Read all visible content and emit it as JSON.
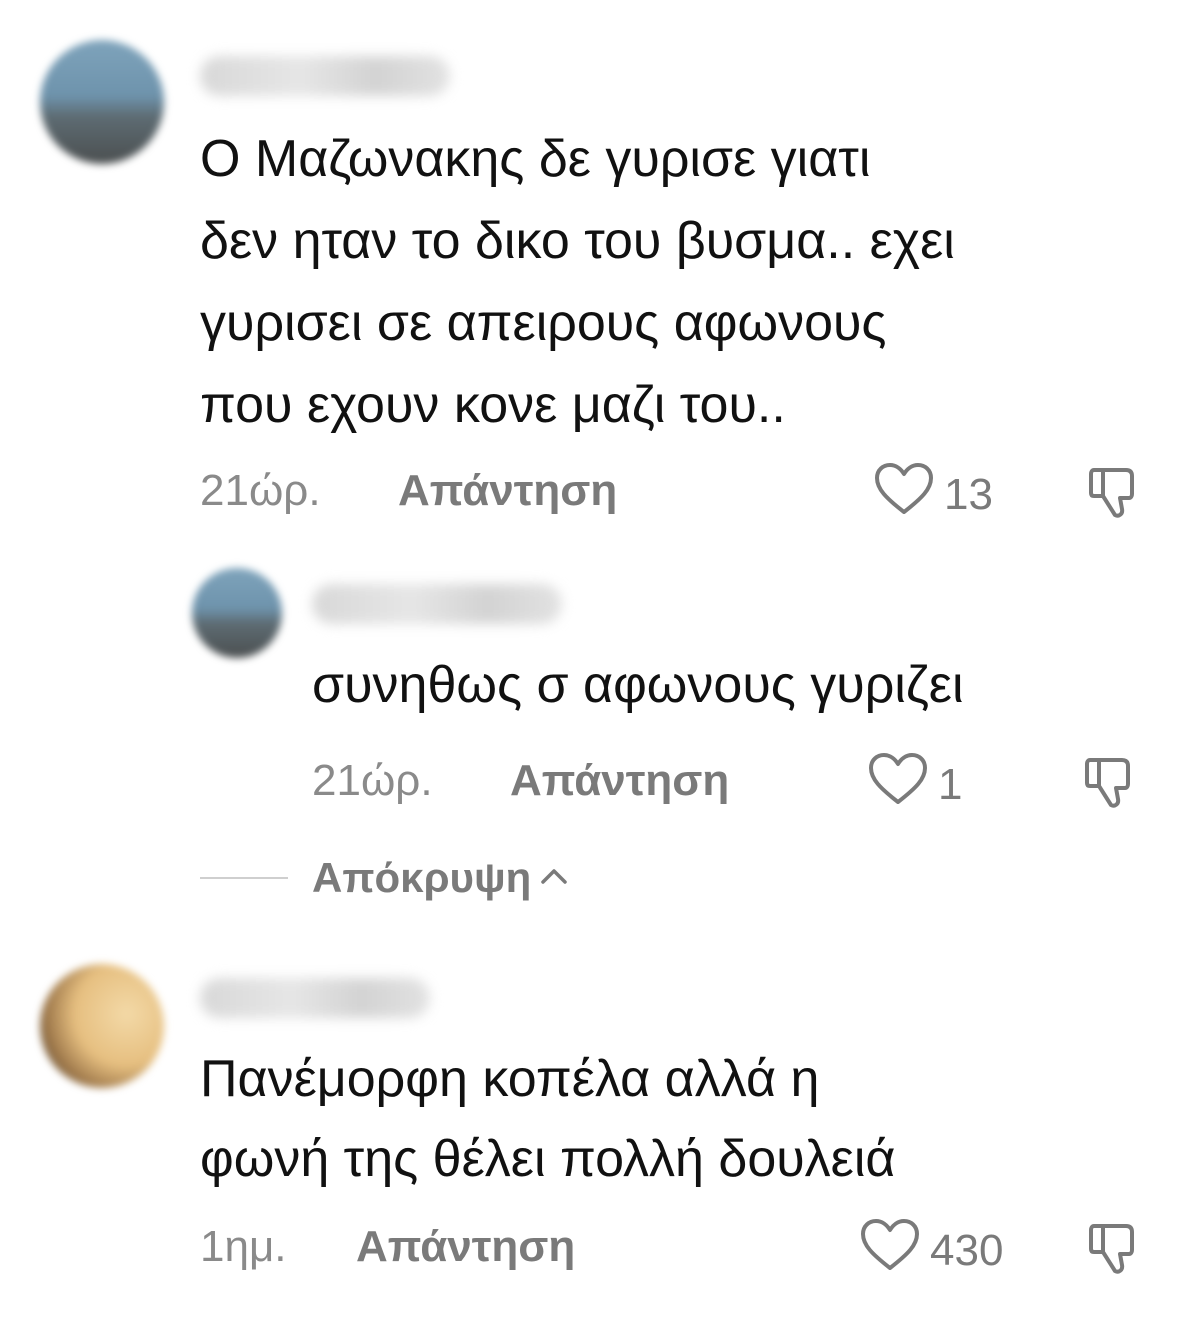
{
  "comments": [
    {
      "text_lines": [
        "Ο Μαζωνακης δε γυρισε γιατι",
        "δεν ηταν το δικο του βυσμα.. εχει",
        "γυρισει σε απειρους αφωνους",
        "που εχουν κονε μαζι του.."
      ],
      "time": "21ώρ.",
      "reply_label": "Απάντηση",
      "likes": "13"
    },
    {
      "text_lines": [
        "συνηθως σ αφωνους γυριζει"
      ],
      "time": "21ώρ.",
      "reply_label": "Απάντηση",
      "likes": "1"
    },
    {
      "text_lines": [
        "Πανέμορφη κοπέλα αλλά η",
        "φωνή της θέλει πολλή δουλειά"
      ],
      "time": "1ημ.",
      "reply_label": "Απάντηση",
      "likes": "430"
    }
  ],
  "hide_replies": {
    "label": "Απόκρυψη"
  },
  "icons": {
    "like": "heart-outline-icon",
    "dislike": "thumbs-down-icon",
    "collapse": "chevron-up-icon"
  },
  "colors": {
    "text": "#111111",
    "meta": "#8a8a8a",
    "icon": "#7a7a7a"
  }
}
